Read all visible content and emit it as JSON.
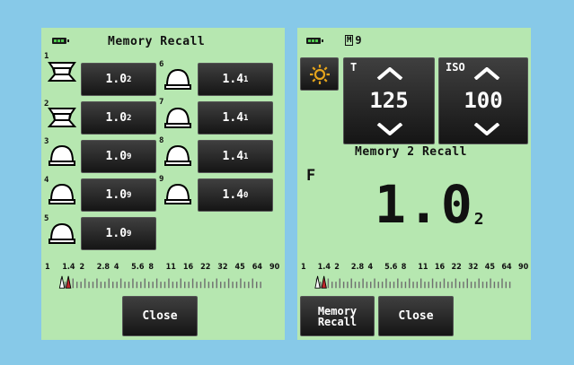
{
  "left": {
    "title": "Memory Recall",
    "memories": [
      {
        "num": "1",
        "value": "1.0",
        "sub": "2",
        "icon": "flat-receptor-icon"
      },
      {
        "num": "2",
        "value": "1.0",
        "sub": "2",
        "icon": "flat-receptor-icon"
      },
      {
        "num": "3",
        "value": "1.0",
        "sub": "9",
        "icon": "dome-receptor-icon"
      },
      {
        "num": "4",
        "value": "1.0",
        "sub": "9",
        "icon": "dome-receptor-icon"
      },
      {
        "num": "5",
        "value": "1.0",
        "sub": "9",
        "icon": "dome-receptor-icon"
      },
      {
        "num": "6",
        "value": "1.4",
        "sub": "1",
        "icon": "dome-receptor-icon"
      },
      {
        "num": "7",
        "value": "1.4",
        "sub": "1",
        "icon": "dome-receptor-icon"
      },
      {
        "num": "8",
        "value": "1.4",
        "sub": "1",
        "icon": "dome-receptor-icon"
      },
      {
        "num": "9",
        "value": "1.4",
        "sub": "0",
        "icon": "dome-receptor-icon"
      }
    ],
    "scale": [
      "1",
      "1.4",
      "2",
      "2.8",
      "4",
      "5.6",
      "8",
      "11",
      "16",
      "22",
      "32",
      "45",
      "64",
      "90"
    ],
    "close_label": "Close"
  },
  "right": {
    "memory_badge": "M",
    "memory_index": "9",
    "mode_icon": "sun-icon",
    "t_label": "T",
    "t_value": "125",
    "iso_label": "ISO",
    "iso_value": "100",
    "recall_title": "Memory 2 Recall",
    "f_label": "F",
    "f_value": "1.0",
    "f_sub": "2",
    "scale": [
      "1",
      "1.4",
      "2",
      "2.8",
      "4",
      "5.6",
      "8",
      "11",
      "16",
      "22",
      "32",
      "45",
      "64",
      "90"
    ],
    "memory_recall_label": "Memory Recall",
    "close_label": "Close"
  },
  "colors": {
    "background": "#87c9e8",
    "screen": "#b6e7b0",
    "button": "#1e1e1e",
    "marker_red": "#c0282b"
  }
}
